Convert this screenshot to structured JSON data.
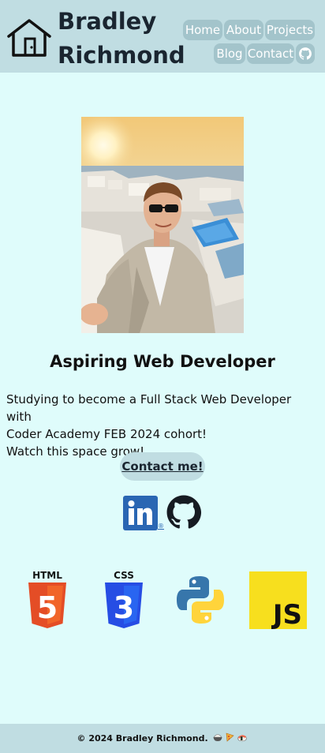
{
  "header": {
    "site_name_line1": "Bradley",
    "site_name_line2": "Richmond",
    "nav": [
      "Home",
      "About",
      "Projects",
      "Blog",
      "Contact"
    ]
  },
  "hero": {
    "headline": "Aspiring Web Developer",
    "intro_line1": "Studying to become a Full Stack Web Developer with",
    "intro_line2": "Coder Academy FEB 2024 cohort!",
    "intro_line3": "Watch this space grow!",
    "cta_label": "Contact me!"
  },
  "social": {
    "linkedin_registered": "®"
  },
  "tech_stack": {
    "html_label": "HTML",
    "css_label": "CSS",
    "js_label": "JS",
    "html_number": "5",
    "css_number": "3"
  },
  "footer": {
    "text": "© 2024 Bradley Richmond."
  },
  "colors": {
    "page_bg": "#dffcfb",
    "header_bg": "#c0dde2",
    "nav_button_bg": "#a3c4cb"
  }
}
